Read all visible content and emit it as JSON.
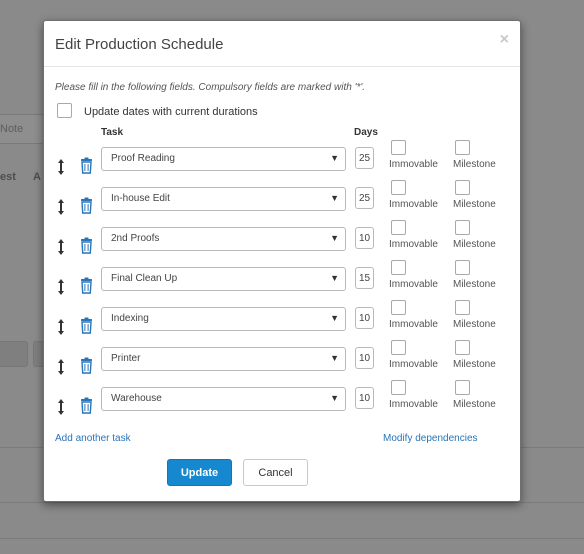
{
  "background": {
    "note_text": "Note",
    "col_a": "est",
    "col_b": "A"
  },
  "dialog": {
    "title": "Edit Production Schedule",
    "close_symbol": "×",
    "instructions": "Please fill in the following fields. Compulsory fields are marked with '*'.",
    "update_dates_label": "Update dates with current durations",
    "update_dates_checked": false,
    "columns": {
      "task": "Task",
      "days": "Days"
    },
    "tasks": [
      {
        "task": "Proof Reading",
        "days": "25",
        "immovable_label": "Immovable",
        "milestone_label": "Milestone"
      },
      {
        "task": "In-house Edit",
        "days": "25",
        "immovable_label": "Immovable",
        "milestone_label": "Milestone"
      },
      {
        "task": "2nd Proofs",
        "days": "10",
        "immovable_label": "Immovable",
        "milestone_label": "Milestone"
      },
      {
        "task": "Final Clean Up",
        "days": "15",
        "immovable_label": "Immovable",
        "milestone_label": "Milestone"
      },
      {
        "task": "Indexing",
        "days": "10",
        "immovable_label": "Immovable",
        "milestone_label": "Milestone"
      },
      {
        "task": "Printer",
        "days": "10",
        "immovable_label": "Immovable",
        "milestone_label": "Milestone"
      },
      {
        "task": "Warehouse",
        "days": "10",
        "immovable_label": "Immovable",
        "milestone_label": "Milestone"
      }
    ],
    "add_task_link": "Add another task",
    "modify_dependencies_link": "Modify dependencies",
    "update_button": "Update",
    "cancel_button": "Cancel",
    "accent_color": "#1688cf",
    "link_color": "#2a74b8",
    "icons": {
      "drag": "drag-handle-icon",
      "delete": "trash-icon",
      "dropdown": "caret-down-icon"
    }
  }
}
